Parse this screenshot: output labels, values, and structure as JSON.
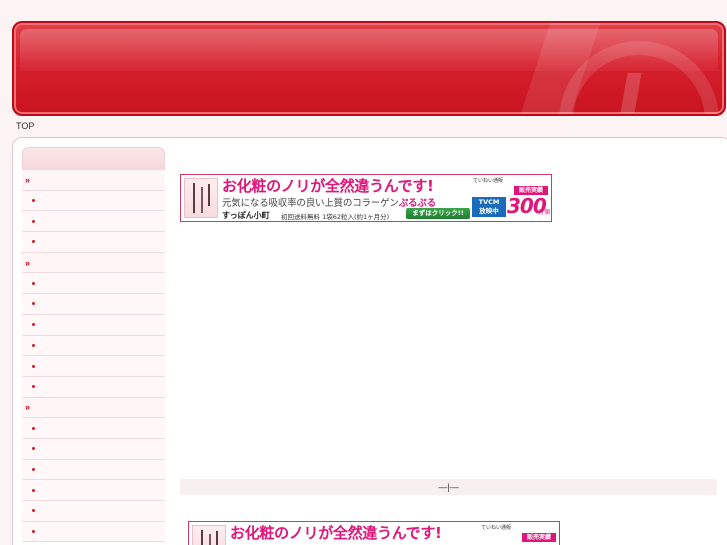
{
  "breadcrumb": {
    "home": "TOP"
  },
  "sidebar": {
    "rows": [
      {
        "type": "section",
        "label": "››"
      },
      {
        "type": "item",
        "label": ""
      },
      {
        "type": "item",
        "label": ""
      },
      {
        "type": "item",
        "label": ""
      },
      {
        "type": "section",
        "label": "››"
      },
      {
        "type": "item",
        "label": ""
      },
      {
        "type": "item",
        "label": ""
      },
      {
        "type": "item",
        "label": ""
      },
      {
        "type": "item",
        "label": ""
      },
      {
        "type": "item",
        "label": ""
      },
      {
        "type": "item",
        "label": ""
      },
      {
        "type": "section",
        "label": "››"
      },
      {
        "type": "item",
        "label": ""
      },
      {
        "type": "item",
        "label": ""
      },
      {
        "type": "item",
        "label": ""
      },
      {
        "type": "item",
        "label": ""
      },
      {
        "type": "item",
        "label": ""
      },
      {
        "type": "item",
        "label": ""
      }
    ]
  },
  "ad": {
    "headline": "お化粧のノリが全然違うんです!",
    "sub_prefix": "元気になる吸収率の良い上質のコラーゲン",
    "sub_accent": "ぷるぷる",
    "brand": "すっぽん小町",
    "info": "初回送料無料 1袋62粒入(約1ヶ月分)",
    "cta": "まずはクリック!!",
    "shop": "ていねい通販",
    "sold_badge": "販売実績",
    "tvcm_line1": "TVCM",
    "tvcm_line2": "放映中",
    "big_number": "300",
    "unit": "万個"
  },
  "pager": {
    "text": "—|—"
  },
  "colors": {
    "header_red": "#d61f2c",
    "accent_pink": "#e0157a",
    "sidebar_text": "#c4101b"
  }
}
